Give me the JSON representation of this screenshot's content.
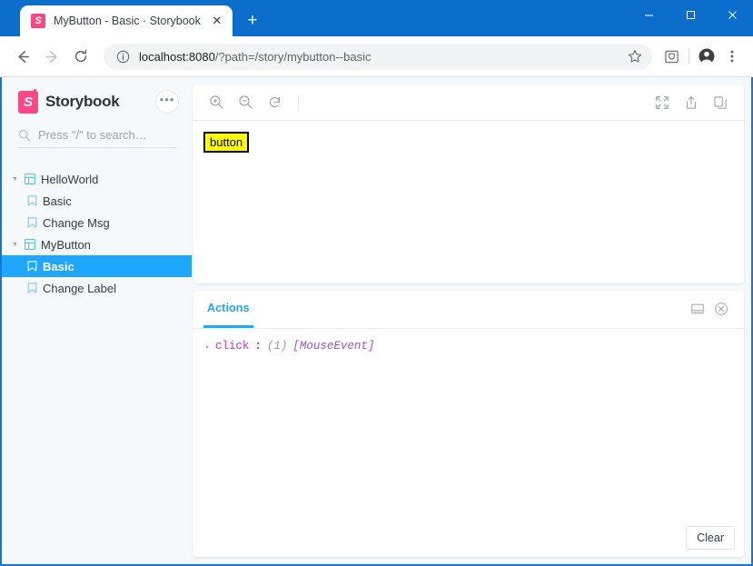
{
  "browser": {
    "tab": {
      "title": "MyButton - Basic · Storybook",
      "favicon": "storybook-favicon",
      "close_label": "✕"
    },
    "new_tab_label": "+",
    "window_controls": {
      "minimize": "−",
      "maximize": "▢",
      "close": "✕"
    },
    "nav": {
      "back": "←",
      "forward": "→",
      "reload": "⟳"
    },
    "omnibox": {
      "info_icon": "info-icon",
      "url_host": "localhost:8080",
      "url_path": "/?path=/story/mybutton--basic",
      "bookmark_icon": "star-icon",
      "extension_icon": "extension-icon",
      "profile_icon": "profile-icon",
      "menu_icon": "three-dot-menu-icon"
    }
  },
  "sidebar": {
    "brand": "Storybook",
    "logo_letter": "S",
    "menu_label": "•••",
    "search": {
      "placeholder": "Press \"/\" to search…",
      "icon": "search-icon"
    },
    "tree": [
      {
        "label": "HelloWorld",
        "type": "component",
        "expanded": true,
        "selected": false
      },
      {
        "label": "Basic",
        "type": "story",
        "selected": false
      },
      {
        "label": "Change Msg",
        "type": "story",
        "selected": false
      },
      {
        "label": "MyButton",
        "type": "component",
        "expanded": true,
        "selected": false
      },
      {
        "label": "Basic",
        "type": "story",
        "selected": true
      },
      {
        "label": "Change Label",
        "type": "story",
        "selected": false
      }
    ]
  },
  "preview": {
    "toolbar": {
      "zoom_in": "zoom-in-icon",
      "zoom_out": "zoom-out-icon",
      "zoom_reset": "zoom-reset-icon",
      "fullscreen": "fullscreen-icon",
      "share": "share-icon",
      "copy": "copy-icon"
    },
    "story_button_label": "button",
    "story_button_bg": "#ffff00",
    "story_button_border": "#000000"
  },
  "panel": {
    "tab_label": "Actions",
    "accent_color": "#1ea7fd",
    "position_icon": "panel-position-icon",
    "close_icon": "close-circle-icon",
    "logs": [
      {
        "caret": "▸",
        "key": "click",
        "colon": ":",
        "count": "(1)",
        "type": "[MouseEvent]"
      }
    ],
    "clear_label": "Clear"
  }
}
